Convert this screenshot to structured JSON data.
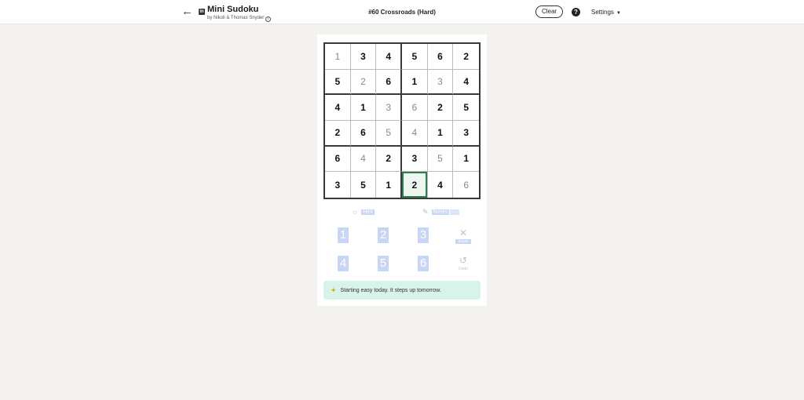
{
  "header": {
    "back_icon": "arrow-left-icon",
    "app_title": "Mini Sudoku",
    "byline": "by Nikoli & Thomas Snyder",
    "puzzle_title": "#60 Crossroads (Hard)",
    "clear_label": "Clear",
    "help_glyph": "?",
    "settings_label": "Settings"
  },
  "grid": {
    "rows": [
      [
        {
          "v": "1",
          "t": "entered"
        },
        {
          "v": "3",
          "t": "given"
        },
        {
          "v": "4",
          "t": "given"
        },
        {
          "v": "5",
          "t": "given"
        },
        {
          "v": "6",
          "t": "given"
        },
        {
          "v": "2",
          "t": "given"
        }
      ],
      [
        {
          "v": "5",
          "t": "given"
        },
        {
          "v": "2",
          "t": "entered"
        },
        {
          "v": "6",
          "t": "given"
        },
        {
          "v": "1",
          "t": "given"
        },
        {
          "v": "3",
          "t": "entered"
        },
        {
          "v": "4",
          "t": "given"
        }
      ],
      [
        {
          "v": "4",
          "t": "given"
        },
        {
          "v": "1",
          "t": "given"
        },
        {
          "v": "3",
          "t": "entered"
        },
        {
          "v": "6",
          "t": "entered"
        },
        {
          "v": "2",
          "t": "given"
        },
        {
          "v": "5",
          "t": "given"
        }
      ],
      [
        {
          "v": "2",
          "t": "given"
        },
        {
          "v": "6",
          "t": "given"
        },
        {
          "v": "5",
          "t": "entered"
        },
        {
          "v": "4",
          "t": "entered"
        },
        {
          "v": "1",
          "t": "given"
        },
        {
          "v": "3",
          "t": "given"
        }
      ],
      [
        {
          "v": "6",
          "t": "given"
        },
        {
          "v": "4",
          "t": "entered"
        },
        {
          "v": "2",
          "t": "given"
        },
        {
          "v": "3",
          "t": "given"
        },
        {
          "v": "5",
          "t": "entered"
        },
        {
          "v": "1",
          "t": "given"
        }
      ],
      [
        {
          "v": "3",
          "t": "given"
        },
        {
          "v": "5",
          "t": "given"
        },
        {
          "v": "1",
          "t": "given"
        },
        {
          "v": "2",
          "t": "given"
        },
        {
          "v": "4",
          "t": "given"
        },
        {
          "v": "6",
          "t": "entered"
        }
      ]
    ],
    "selected": [
      5,
      3
    ]
  },
  "tools": {
    "hint_label": "Hint",
    "notes_label": "Notes"
  },
  "keypad": {
    "numbers": [
      "1",
      "2",
      "3",
      "4",
      "5",
      "6"
    ],
    "erase_label": "Erase",
    "undo_label": "Undo"
  },
  "banner": {
    "text": "Starting easy today. It steps up tomorrow."
  },
  "colors": {
    "selected_border": "#2e7d4f",
    "banner_bg": "#d8f3ea",
    "page_bg": "#f3f2ef"
  }
}
